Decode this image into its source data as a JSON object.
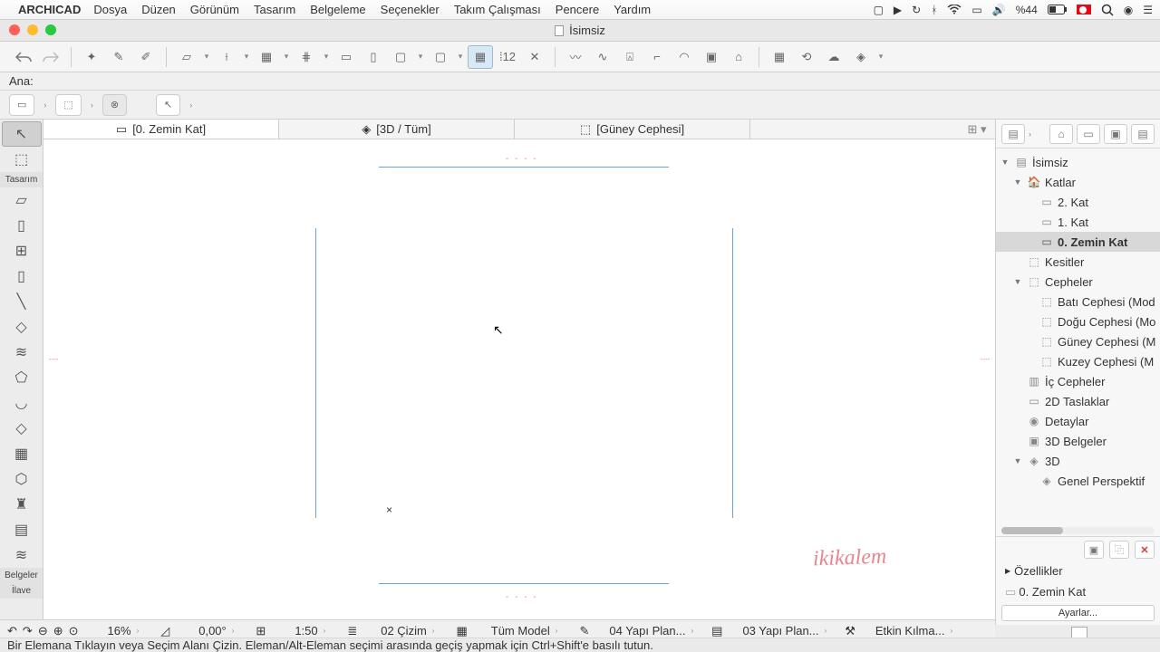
{
  "menubar": {
    "app": "ARCHICAD",
    "items": [
      "Dosya",
      "Düzen",
      "Görünüm",
      "Tasarım",
      "Belgeleme",
      "Seçenekler",
      "Takım Çalışması",
      "Pencere",
      "Yardım"
    ],
    "battery": "%44"
  },
  "window": {
    "title": "İsimsiz"
  },
  "infobar": {
    "label": "Ana:"
  },
  "toolbox": {
    "section1": "Tasarım",
    "section2": "Belgeler",
    "section3": "İlave"
  },
  "tabs": [
    {
      "label": "[0. Zemin Kat]",
      "active": true
    },
    {
      "label": "[3D / Tüm]",
      "active": false
    },
    {
      "label": "[Güney Cephesi]",
      "active": false
    }
  ],
  "navigator": {
    "tree": [
      {
        "label": "İsimsiz",
        "indent": 0,
        "arrow": "▼",
        "icon": "▤"
      },
      {
        "label": "Katlar",
        "indent": 1,
        "arrow": "▼",
        "icon": "🏠"
      },
      {
        "label": "2. Kat",
        "indent": 2,
        "arrow": "",
        "icon": "▭"
      },
      {
        "label": "1. Kat",
        "indent": 2,
        "arrow": "",
        "icon": "▭"
      },
      {
        "label": "0. Zemin Kat",
        "indent": 2,
        "arrow": "",
        "icon": "▭",
        "selected": true
      },
      {
        "label": "Kesitler",
        "indent": 1,
        "arrow": "",
        "icon": "⬚"
      },
      {
        "label": "Cepheler",
        "indent": 1,
        "arrow": "▼",
        "icon": "⬚"
      },
      {
        "label": "Batı Cephesi (Mod",
        "indent": 2,
        "arrow": "",
        "icon": "⬚"
      },
      {
        "label": "Doğu Cephesi (Mo",
        "indent": 2,
        "arrow": "",
        "icon": "⬚"
      },
      {
        "label": "Güney Cephesi (M",
        "indent": 2,
        "arrow": "",
        "icon": "⬚"
      },
      {
        "label": "Kuzey Cephesi (M",
        "indent": 2,
        "arrow": "",
        "icon": "⬚"
      },
      {
        "label": "İç Cepheler",
        "indent": 1,
        "arrow": "",
        "icon": "▥"
      },
      {
        "label": "2D Taslaklar",
        "indent": 1,
        "arrow": "",
        "icon": "▭"
      },
      {
        "label": "Detaylar",
        "indent": 1,
        "arrow": "",
        "icon": "◉"
      },
      {
        "label": "3D Belgeler",
        "indent": 1,
        "arrow": "",
        "icon": "▣"
      },
      {
        "label": "3D",
        "indent": 1,
        "arrow": "▼",
        "icon": "◈"
      },
      {
        "label": "Genel Perspektif",
        "indent": 2,
        "arrow": "",
        "icon": "◈"
      }
    ],
    "properties_label": "Özellikler",
    "current": "0.     Zemin Kat",
    "settings": "Ayarlar..."
  },
  "statusbar": {
    "zoom": "16%",
    "angle": "0,00°",
    "scale": "1:50",
    "layer": "02 Çizim",
    "model": "Tüm Model",
    "plan1": "04 Yapı Plan...",
    "plan2": "03 Yapı Plan...",
    "renov": "Etkin Kılma..."
  },
  "hint": "Bir Elemana Tıklayın veya Seçim Alanı Çizin.   Eleman/Alt-Eleman seçimi arasında geçiş yapmak için Ctrl+Shift'e basılı tutun.",
  "watermark": "ikikalem"
}
